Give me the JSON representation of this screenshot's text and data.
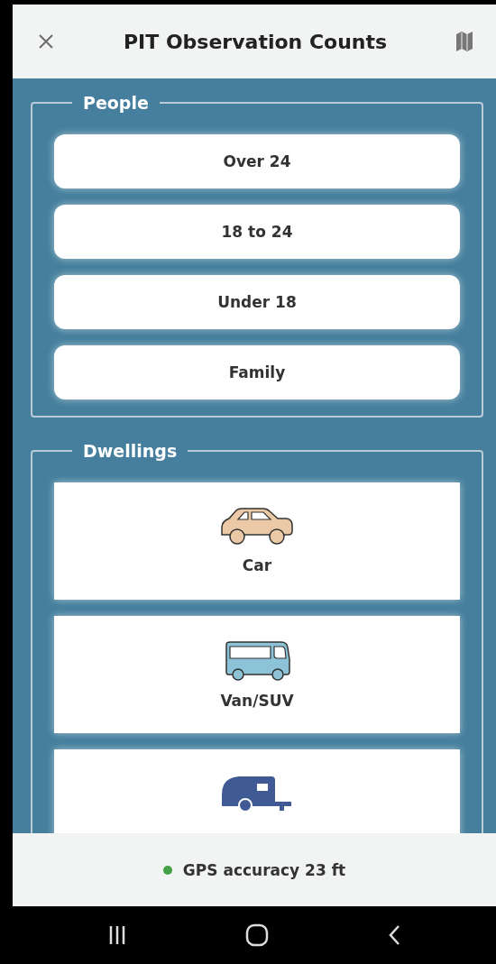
{
  "header": {
    "title": "PIT Observation Counts"
  },
  "sections": [
    {
      "legend": "People",
      "kind": "buttons",
      "items": [
        {
          "label": "Over 24"
        },
        {
          "label": "18 to 24"
        },
        {
          "label": "Under 18"
        },
        {
          "label": "Family"
        }
      ]
    },
    {
      "legend": "Dwellings",
      "kind": "cards",
      "items": [
        {
          "label": "Car",
          "kind": "car"
        },
        {
          "label": "Van/SUV",
          "kind": "van"
        },
        {
          "kind": "camper"
        }
      ]
    }
  ],
  "status_bar": {
    "text": "GPS accuracy 23 ft",
    "color": "#43a047"
  }
}
